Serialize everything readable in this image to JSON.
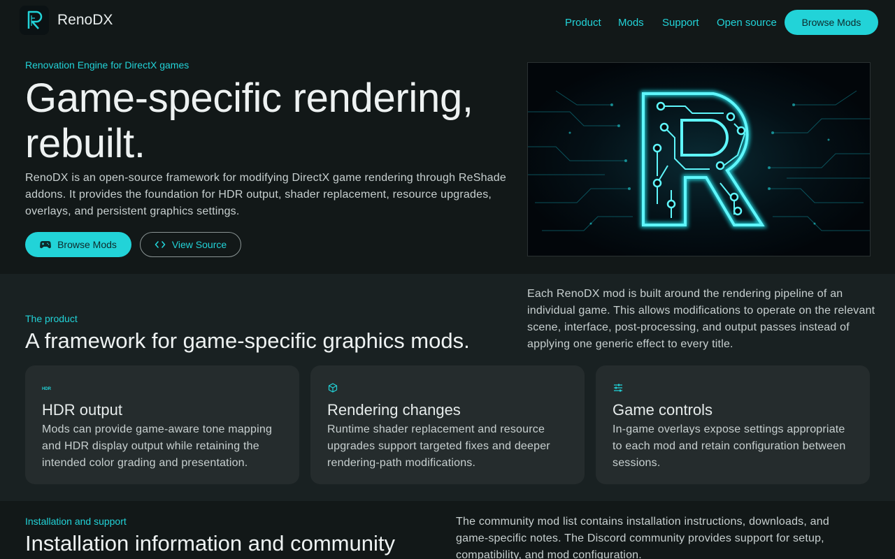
{
  "header": {
    "brand": "RenoDX",
    "logo_icon": "renodx-logo-icon",
    "nav": [
      "Product",
      "Mods",
      "Support",
      "Open source"
    ],
    "cta": "Browse Mods"
  },
  "hero": {
    "eyebrow": "Renovation Engine for DirectX games",
    "title": "Game-specific rendering, rebuilt.",
    "description": "RenoDX is an open-source framework for modifying DirectX game rendering through ReShade addons. It provides the foundation for HDR output, shader replacement, resource upgrades, overlays, and persistent graphics settings.",
    "primary_button": "Browse Mods",
    "primary_icon": "gamepad-icon",
    "secondary_button": "View Source",
    "secondary_icon": "code-icon",
    "image": "neon-circuit-r-logo"
  },
  "product": {
    "eyebrow": "The product",
    "title": "A framework for game-specific graphics mods.",
    "description": "Each RenoDX mod is built around the rendering pipeline of an individual game. This allows modifications to operate on the relevant scene, interface, post-processing, and output passes instead of applying one generic effect to every title.",
    "cards": [
      {
        "icon": "hdr-icon",
        "icon_text": "HDR",
        "title": "HDR output",
        "text": "Mods can provide game-aware tone mapping and HDR display output while retaining the intended color grading and presentation."
      },
      {
        "icon": "cube-icon",
        "title": "Rendering changes",
        "text": "Runtime shader replacement and resource upgrades support targeted fixes and deeper rendering-path modifications."
      },
      {
        "icon": "sliders-icon",
        "title": "Game controls",
        "text": "In-game overlays expose settings appropriate to each mod and retain configuration between sessions."
      }
    ]
  },
  "install": {
    "eyebrow": "Installation and support",
    "title": "Installation information and community",
    "description": "The community mod list contains installation instructions, downloads, and game-specific notes. The Discord community provides support for setup, compatibility, and mod configuration."
  },
  "colors": {
    "accent": "#22d3d8",
    "background": "#121818",
    "section": "#192122",
    "card": "#252c2d"
  }
}
